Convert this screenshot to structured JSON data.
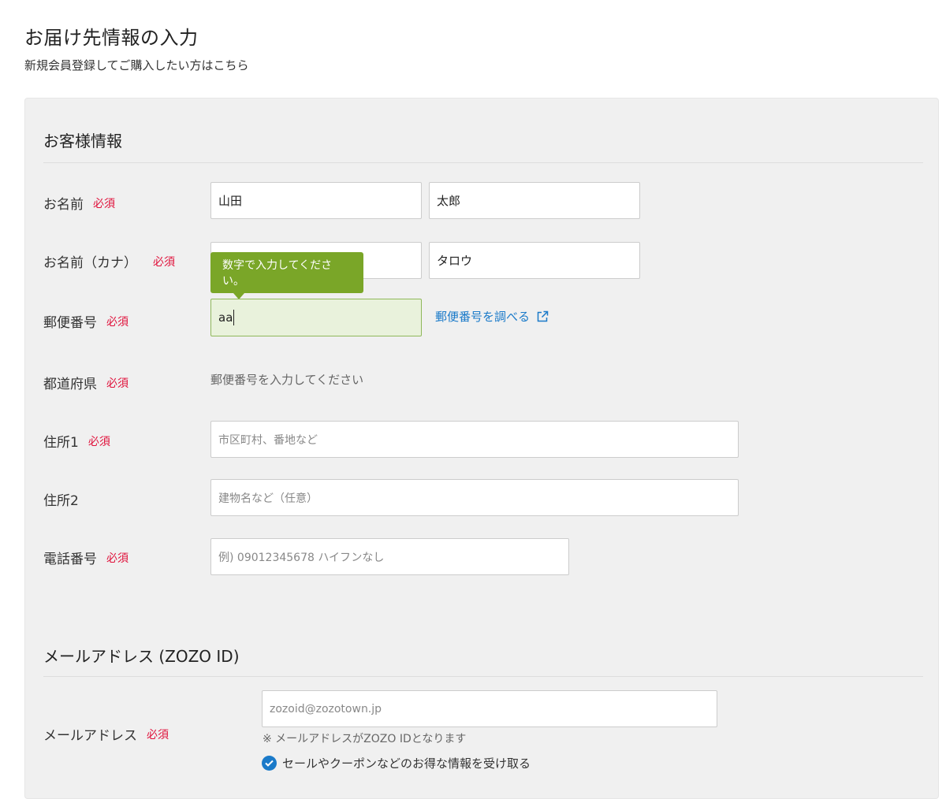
{
  "page": {
    "title": "お届け先情報の入力",
    "register_link": "新規会員登録してご購入したい方はこちら"
  },
  "customer": {
    "section_title": "お客様情報",
    "required": "必須",
    "name": {
      "label": "お名前",
      "last_value": "山田",
      "first_value": "太郎"
    },
    "kana": {
      "label": "お名前（カナ）",
      "first_value": "タロウ"
    },
    "tooltip": "数字で入力してください。",
    "postal": {
      "label": "郵便番号",
      "value": "aa",
      "lookup_link": "郵便番号を調べる"
    },
    "prefecture": {
      "label": "都道府県",
      "hint": "郵便番号を入力してください"
    },
    "address1": {
      "label": "住所1",
      "placeholder": "市区町村、番地など"
    },
    "address2": {
      "label": "住所2",
      "placeholder": "建物名など（任意）"
    },
    "phone": {
      "label": "電話番号",
      "placeholder": "例) 09012345678 ハイフンなし"
    }
  },
  "email": {
    "section_title": "メールアドレス (ZOZO ID)",
    "label": "メールアドレス",
    "placeholder": "zozoid@zozotown.jp",
    "note": "※ メールアドレスがZOZO IDとなります",
    "optin_label": "セールやクーポンなどのお得な情報を受け取る",
    "optin_checked": true
  },
  "colors": {
    "required": "#e0103a",
    "link": "#1a7ac9",
    "tooltip": "#7aa628",
    "active_field_bg": "#e9f2dc"
  }
}
